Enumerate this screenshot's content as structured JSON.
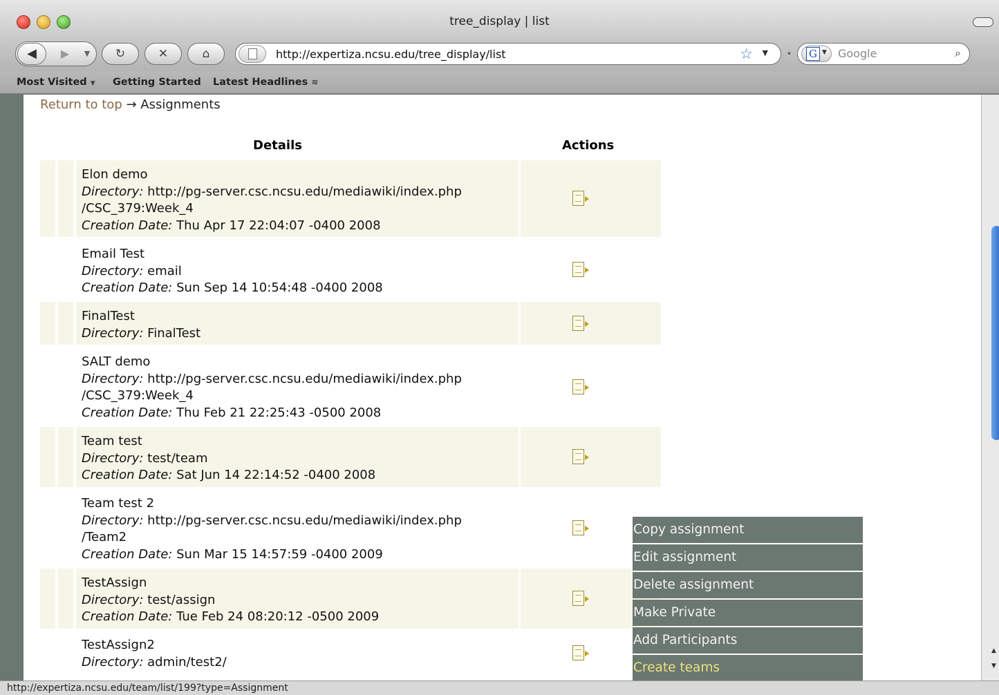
{
  "window": {
    "title": "tree_display | list"
  },
  "toolbar": {
    "url": "http://expertiza.ncsu.edu/tree_display/list",
    "search_placeholder": "Google"
  },
  "bookmarks": [
    "Most Visited",
    "Getting Started",
    "Latest Headlines"
  ],
  "breadcrumb": {
    "link": "Return to top",
    "current": "→ Assignments"
  },
  "table": {
    "headers": {
      "details": "Details",
      "actions": "Actions"
    },
    "labels": {
      "directory": "Directory:",
      "creation_date": "Creation Date:"
    },
    "rows": [
      {
        "name": "Elon demo",
        "directory": "http://pg-server.csc.ncsu.edu/mediawiki/index.php",
        "directory_cont": "/CSC_379:Week_4",
        "date": "Thu Apr 17 22:04:07 -0400 2008"
      },
      {
        "name": "Email Test",
        "directory": "email",
        "date": "Sun Sep 14 10:54:48 -0400 2008"
      },
      {
        "name": "FinalTest",
        "directory": "FinalTest"
      },
      {
        "name": "SALT demo",
        "directory": "http://pg-server.csc.ncsu.edu/mediawiki/index.php",
        "directory_cont": "/CSC_379:Week_4",
        "date": "Thu Feb 21 22:25:43 -0500 2008"
      },
      {
        "name": "Team test",
        "directory": "test/team",
        "date": "Sat Jun 14 22:14:52 -0400 2008"
      },
      {
        "name": "Team test 2",
        "directory": "http://pg-server.csc.ncsu.edu/mediawiki/index.php",
        "directory_cont": "/Team2",
        "date": "Sun Mar 15 14:57:59 -0400 2009"
      },
      {
        "name": "TestAssign",
        "directory": "test/assign",
        "date": "Tue Feb 24 08:20:12 -0500 2009"
      },
      {
        "name": "TestAssign2",
        "directory": "admin/test2/"
      }
    ]
  },
  "menu": [
    "Copy assignment",
    "Edit assignment",
    "Delete assignment",
    "Make Private",
    "Add Participants",
    "Create teams"
  ],
  "status": {
    "text": "http://expertiza.ncsu.edu/team/list/199?type=Assignment"
  },
  "colors": {
    "chrome": "#6b7771",
    "row_shade": "#f6f6e8",
    "link": "#8a6a44",
    "menu_highlight": "#e9e27b"
  }
}
